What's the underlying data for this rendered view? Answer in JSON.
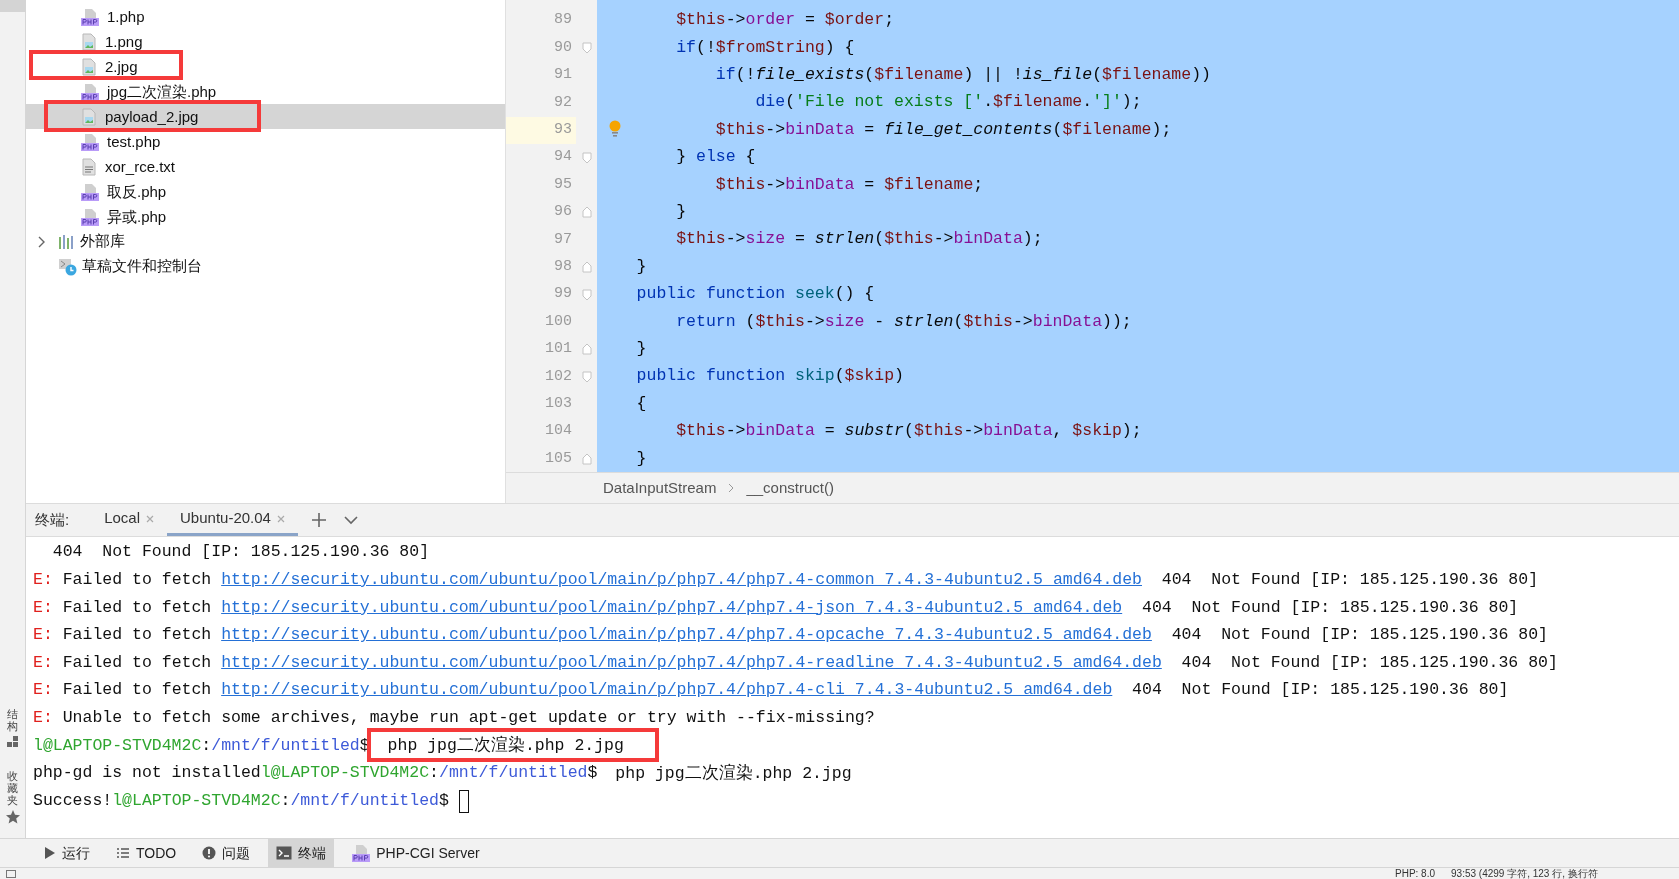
{
  "side_strip": {
    "tabs": [
      {
        "label": "结构",
        "kind": "structure"
      },
      {
        "label": "收藏夹",
        "kind": "favorites"
      }
    ]
  },
  "project_tree": {
    "items": [
      {
        "name": "1.php",
        "kind": "php",
        "selected": false
      },
      {
        "name": "1.png",
        "kind": "image",
        "selected": false
      },
      {
        "name": "2.jpg",
        "kind": "image",
        "selected": false
      },
      {
        "name": "jpg二次渲染.php",
        "kind": "php",
        "selected": false
      },
      {
        "name": "payload_2.jpg",
        "kind": "image",
        "selected": true
      },
      {
        "name": "test.php",
        "kind": "php",
        "selected": false
      },
      {
        "name": "xor_rce.txt",
        "kind": "text",
        "selected": false
      },
      {
        "name": "取反.php",
        "kind": "php",
        "selected": false
      },
      {
        "name": "异或.php",
        "kind": "php",
        "selected": false
      }
    ],
    "groups": [
      {
        "label": "外部库",
        "kind": "library",
        "expanded": false
      },
      {
        "label": "草稿文件和控制台",
        "kind": "scratch"
      }
    ]
  },
  "editor": {
    "lines": [
      {
        "number": "89",
        "current": false,
        "fold_open": false,
        "fold_close": false,
        "tokens": [
          {
            "text": "        $this",
            "kind": "variable"
          },
          {
            "text": "->",
            "kind": "plain"
          },
          {
            "text": "order",
            "kind": "field"
          },
          {
            "text": " = ",
            "kind": "plain"
          },
          {
            "text": "$order",
            "kind": "variable"
          },
          {
            "text": ";",
            "kind": "plain"
          }
        ]
      },
      {
        "number": "90",
        "current": false,
        "fold_open": true,
        "fold_close": false,
        "tokens": [
          {
            "text": "        if",
            "kind": "keyword"
          },
          {
            "text": "(!",
            "kind": "plain"
          },
          {
            "text": "$fromString",
            "kind": "variable"
          },
          {
            "text": ") {",
            "kind": "plain"
          }
        ]
      },
      {
        "number": "91",
        "current": false,
        "fold_open": false,
        "fold_close": false,
        "tokens": [
          {
            "text": "            if",
            "kind": "keyword"
          },
          {
            "text": "(!",
            "kind": "plain"
          },
          {
            "text": "file_exists",
            "kind": "call"
          },
          {
            "text": "(",
            "kind": "plain"
          },
          {
            "text": "$filename",
            "kind": "variable"
          },
          {
            "text": ") || !",
            "kind": "plain"
          },
          {
            "text": "is_file",
            "kind": "call"
          },
          {
            "text": "(",
            "kind": "plain"
          },
          {
            "text": "$filename",
            "kind": "variable"
          },
          {
            "text": "))",
            "kind": "plain"
          }
        ]
      },
      {
        "number": "92",
        "current": false,
        "fold_open": false,
        "fold_close": false,
        "tokens": [
          {
            "text": "                die",
            "kind": "keyword"
          },
          {
            "text": "(",
            "kind": "plain"
          },
          {
            "text": "'File not exists ['",
            "kind": "string"
          },
          {
            "text": ".",
            "kind": "plain"
          },
          {
            "text": "$filename",
            "kind": "variable"
          },
          {
            "text": ".",
            "kind": "plain"
          },
          {
            "text": "']'",
            "kind": "string"
          },
          {
            "text": ");",
            "kind": "plain"
          }
        ]
      },
      {
        "number": "93",
        "current": true,
        "fold_open": false,
        "fold_close": false,
        "tokens": [
          {
            "text": "            $this",
            "kind": "variable"
          },
          {
            "text": "->",
            "kind": "plain"
          },
          {
            "text": "binData",
            "kind": "field"
          },
          {
            "text": " = ",
            "kind": "plain"
          },
          {
            "text": "file_get_contents",
            "kind": "call"
          },
          {
            "text": "(",
            "kind": "plain"
          },
          {
            "text": "$filename",
            "kind": "variable"
          },
          {
            "text": ");",
            "kind": "plain"
          }
        ]
      },
      {
        "number": "94",
        "current": false,
        "fold_open": true,
        "fold_close": false,
        "tokens": [
          {
            "text": "        } ",
            "kind": "plain"
          },
          {
            "text": "else",
            "kind": "keyword"
          },
          {
            "text": " {",
            "kind": "plain"
          }
        ]
      },
      {
        "number": "95",
        "current": false,
        "fold_open": false,
        "fold_close": false,
        "tokens": [
          {
            "text": "            $this",
            "kind": "variable"
          },
          {
            "text": "->",
            "kind": "plain"
          },
          {
            "text": "binData",
            "kind": "field"
          },
          {
            "text": " = ",
            "kind": "plain"
          },
          {
            "text": "$filename",
            "kind": "variable"
          },
          {
            "text": ";",
            "kind": "plain"
          }
        ]
      },
      {
        "number": "96",
        "current": false,
        "fold_open": false,
        "fold_close": true,
        "tokens": [
          {
            "text": "        }",
            "kind": "plain"
          }
        ]
      },
      {
        "number": "97",
        "current": false,
        "fold_open": false,
        "fold_close": false,
        "tokens": [
          {
            "text": "        $this",
            "kind": "variable"
          },
          {
            "text": "->",
            "kind": "plain"
          },
          {
            "text": "size",
            "kind": "field"
          },
          {
            "text": " = ",
            "kind": "plain"
          },
          {
            "text": "strlen",
            "kind": "call"
          },
          {
            "text": "(",
            "kind": "plain"
          },
          {
            "text": "$this",
            "kind": "variable"
          },
          {
            "text": "->",
            "kind": "plain"
          },
          {
            "text": "binData",
            "kind": "field"
          },
          {
            "text": ");",
            "kind": "plain"
          }
        ]
      },
      {
        "number": "98",
        "current": false,
        "fold_open": false,
        "fold_close": true,
        "tokens": [
          {
            "text": "    }",
            "kind": "plain"
          }
        ]
      },
      {
        "number": "99",
        "current": false,
        "fold_open": true,
        "fold_close": false,
        "tokens": [
          {
            "text": "    public",
            "kind": "keyword"
          },
          {
            "text": " function",
            "kind": "keyword"
          },
          {
            "text": " seek",
            "kind": "method"
          },
          {
            "text": "() {",
            "kind": "plain"
          }
        ]
      },
      {
        "number": "100",
        "current": false,
        "fold_open": false,
        "fold_close": false,
        "tokens": [
          {
            "text": "        return",
            "kind": "keyword"
          },
          {
            "text": " (",
            "kind": "plain"
          },
          {
            "text": "$this",
            "kind": "variable"
          },
          {
            "text": "->",
            "kind": "plain"
          },
          {
            "text": "size",
            "kind": "field"
          },
          {
            "text": " - ",
            "kind": "plain"
          },
          {
            "text": "strlen",
            "kind": "call"
          },
          {
            "text": "(",
            "kind": "plain"
          },
          {
            "text": "$this",
            "kind": "variable"
          },
          {
            "text": "->",
            "kind": "plain"
          },
          {
            "text": "binData",
            "kind": "field"
          },
          {
            "text": "));",
            "kind": "plain"
          }
        ]
      },
      {
        "number": "101",
        "current": false,
        "fold_open": false,
        "fold_close": true,
        "tokens": [
          {
            "text": "    }",
            "kind": "plain"
          }
        ]
      },
      {
        "number": "102",
        "current": false,
        "fold_open": true,
        "fold_close": false,
        "tokens": [
          {
            "text": "    public",
            "kind": "keyword"
          },
          {
            "text": " function",
            "kind": "keyword"
          },
          {
            "text": " skip",
            "kind": "method"
          },
          {
            "text": "(",
            "kind": "plain"
          },
          {
            "text": "$skip",
            "kind": "variable"
          },
          {
            "text": ")",
            "kind": "plain"
          }
        ]
      },
      {
        "number": "103",
        "current": false,
        "fold_open": false,
        "fold_close": false,
        "tokens": [
          {
            "text": "    {",
            "kind": "plain"
          }
        ]
      },
      {
        "number": "104",
        "current": false,
        "fold_open": false,
        "fold_close": false,
        "tokens": [
          {
            "text": "        $this",
            "kind": "variable"
          },
          {
            "text": "->",
            "kind": "plain"
          },
          {
            "text": "binData",
            "kind": "field"
          },
          {
            "text": " = ",
            "kind": "plain"
          },
          {
            "text": "substr",
            "kind": "call"
          },
          {
            "text": "(",
            "kind": "plain"
          },
          {
            "text": "$this",
            "kind": "variable"
          },
          {
            "text": "->",
            "kind": "plain"
          },
          {
            "text": "binData",
            "kind": "field"
          },
          {
            "text": ", ",
            "kind": "plain"
          },
          {
            "text": "$skip",
            "kind": "variable"
          },
          {
            "text": ");",
            "kind": "plain"
          }
        ]
      },
      {
        "number": "105",
        "current": false,
        "fold_open": false,
        "fold_close": true,
        "tokens": [
          {
            "text": "    }",
            "kind": "plain"
          }
        ]
      }
    ],
    "breadcrumb": [
      "DataInputStream",
      "__construct()"
    ]
  },
  "terminal": {
    "label": "终端:",
    "tabs": [
      {
        "label": "Local",
        "selected": false
      },
      {
        "label": "Ubuntu-20.04",
        "selected": true
      }
    ],
    "lines": [
      {
        "cursor": false,
        "segments": [
          {
            "text": "  404  Not Found [IP: 185.125.190.36 80]",
            "kind": "plain"
          }
        ]
      },
      {
        "cursor": false,
        "segments": [
          {
            "text": "E:",
            "kind": "error"
          },
          {
            "text": " Failed to fetch ",
            "kind": "plain"
          },
          {
            "text": "http://security.ubuntu.com/ubuntu/pool/main/p/php7.4/php7.4-common_7.4.3-4ubuntu2.5_amd64.deb",
            "kind": "link"
          },
          {
            "text": "  404  Not Found [IP: 185.125.190.36 80]",
            "kind": "plain"
          }
        ]
      },
      {
        "cursor": false,
        "segments": [
          {
            "text": "E:",
            "kind": "error"
          },
          {
            "text": " Failed to fetch ",
            "kind": "plain"
          },
          {
            "text": "http://security.ubuntu.com/ubuntu/pool/main/p/php7.4/php7.4-json_7.4.3-4ubuntu2.5_amd64.deb",
            "kind": "link"
          },
          {
            "text": "  404  Not Found [IP: 185.125.190.36 80]",
            "kind": "plain"
          }
        ]
      },
      {
        "cursor": false,
        "segments": [
          {
            "text": "E:",
            "kind": "error"
          },
          {
            "text": " Failed to fetch ",
            "kind": "plain"
          },
          {
            "text": "http://security.ubuntu.com/ubuntu/pool/main/p/php7.4/php7.4-opcache_7.4.3-4ubuntu2.5_amd64.deb",
            "kind": "link"
          },
          {
            "text": "  404  Not Found [IP: 185.125.190.36 80]",
            "kind": "plain"
          }
        ]
      },
      {
        "cursor": false,
        "segments": [
          {
            "text": "E:",
            "kind": "error"
          },
          {
            "text": " Failed to fetch ",
            "kind": "plain"
          },
          {
            "text": "http://security.ubuntu.com/ubuntu/pool/main/p/php7.4/php7.4-readline_7.4.3-4ubuntu2.5_amd64.deb",
            "kind": "link"
          },
          {
            "text": "  404  Not Found [IP: 185.125.190.36 80]",
            "kind": "plain"
          }
        ]
      },
      {
        "cursor": false,
        "segments": [
          {
            "text": "E:",
            "kind": "error"
          },
          {
            "text": " Failed to fetch ",
            "kind": "plain"
          },
          {
            "text": "http://security.ubuntu.com/ubuntu/pool/main/p/php7.4/php7.4-cli_7.4.3-4ubuntu2.5_amd64.deb",
            "kind": "link"
          },
          {
            "text": "  404  Not Found [IP: 185.125.190.36 80]",
            "kind": "plain"
          }
        ]
      },
      {
        "cursor": false,
        "segments": [
          {
            "text": "E:",
            "kind": "error"
          },
          {
            "text": " Unable to fetch some archives, maybe run apt-get update or try with --fix-missing?",
            "kind": "plain"
          }
        ]
      },
      {
        "cursor": false,
        "segments": [
          {
            "text": "l@LAPTOP-STVD4M2C",
            "kind": "user"
          },
          {
            "text": ":",
            "kind": "plain"
          },
          {
            "text": "/mnt/f/untitled",
            "kind": "path"
          },
          {
            "text": "$",
            "kind": "plain"
          },
          {
            "text": " php jpg二次渲染.php 2.jpg",
            "kind": "command"
          }
        ]
      },
      {
        "cursor": false,
        "segments": [
          {
            "text": "php-gd is not installed",
            "kind": "plain"
          },
          {
            "text": "l@LAPTOP-STVD4M2C",
            "kind": "user"
          },
          {
            "text": ":",
            "kind": "plain"
          },
          {
            "text": "/mnt/f/untitled",
            "kind": "path"
          },
          {
            "text": "$",
            "kind": "plain"
          },
          {
            "text": " php jpg二次渲染.php 2.jpg",
            "kind": "command"
          }
        ]
      },
      {
        "cursor": true,
        "segments": [
          {
            "text": "Success!",
            "kind": "plain"
          },
          {
            "text": "l@LAPTOP-STVD4M2C",
            "kind": "user"
          },
          {
            "text": ":",
            "kind": "plain"
          },
          {
            "text": "/mnt/f/untitled",
            "kind": "path"
          },
          {
            "text": "$",
            "kind": "plain"
          }
        ]
      }
    ]
  },
  "tool_bar": {
    "items": [
      {
        "label": "运行",
        "kind": "run",
        "selected": false
      },
      {
        "label": "TODO",
        "kind": "list",
        "selected": false
      },
      {
        "label": "问题",
        "kind": "problem",
        "selected": false
      },
      {
        "label": "终端",
        "kind": "terminal",
        "selected": true
      },
      {
        "label": "PHP-CGI Server",
        "kind": "php",
        "selected": false
      }
    ]
  },
  "status_bar": {
    "items": [
      "PHP: 8.0",
      "93:53 (4299 字符, 123 行, 换行符"
    ]
  }
}
